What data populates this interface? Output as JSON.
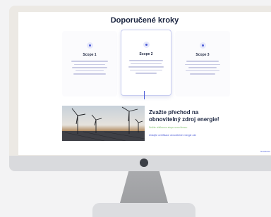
{
  "page": {
    "title": "Doporučené kroky"
  },
  "scopes": [
    {
      "label": "Scope 1",
      "active": false
    },
    {
      "label": "Scope 2",
      "active": true
    },
    {
      "label": "Scope 3",
      "active": false
    }
  ],
  "cta": {
    "title_line1": "Zvažte přechod na",
    "title_line2": "obnovitelný zdroj energie!",
    "subtitle": "Snižte uhlíkovou stopu svou firmou",
    "link": "Získejte certifikace obnovitelné energie zde"
  },
  "corner_label": "Newsletter",
  "colors": {
    "accent": "#4b5bd6",
    "heading": "#1b2540",
    "green": "#7fbf6a"
  }
}
